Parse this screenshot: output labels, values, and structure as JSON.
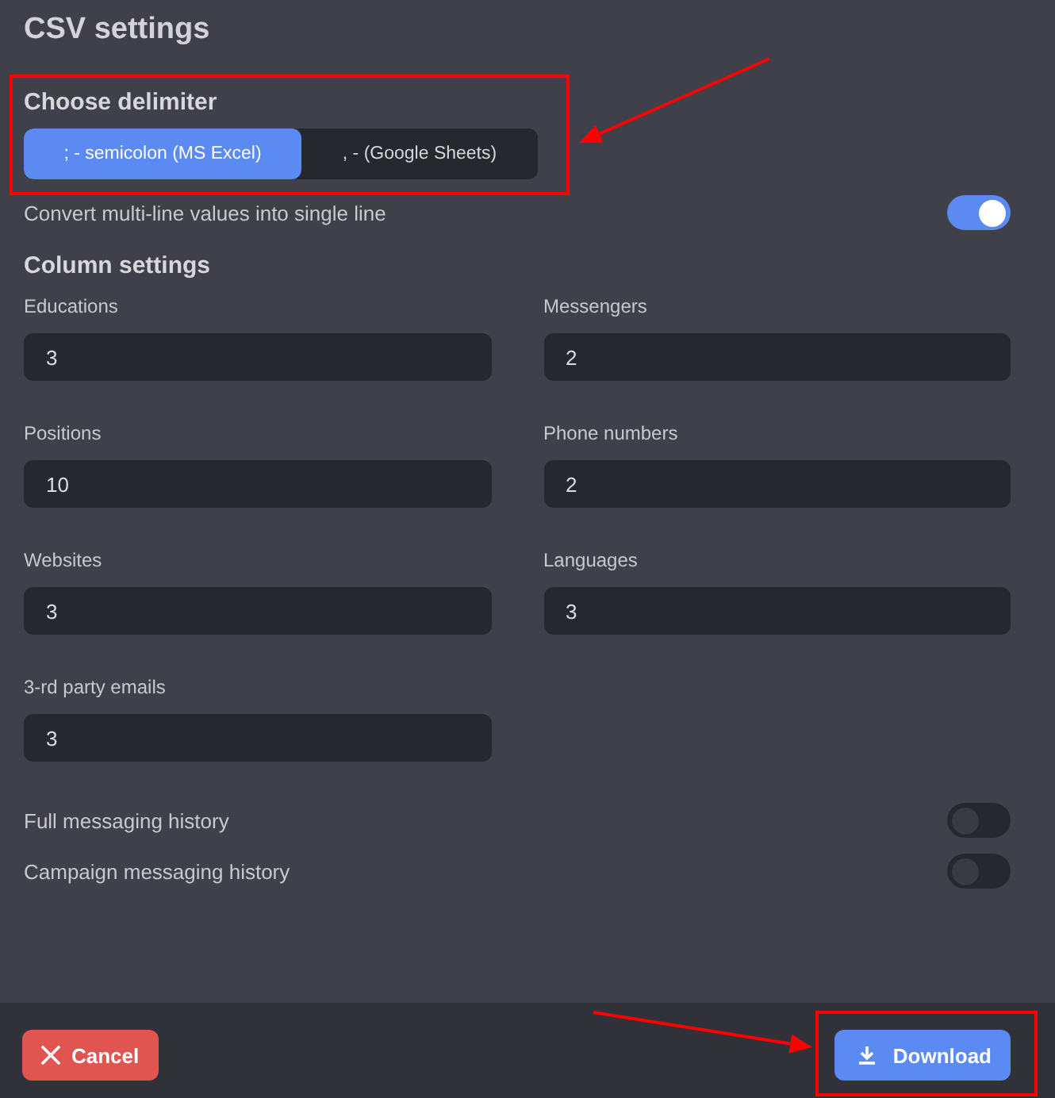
{
  "title": "CSV settings",
  "delimiter": {
    "label": "Choose delimiter",
    "options": [
      {
        "label": "; - semicolon (MS Excel)",
        "selected": true
      },
      {
        "label": ", - (Google Sheets)",
        "selected": false
      }
    ]
  },
  "convert_toggle": {
    "label": "Convert multi-line values into single line",
    "on": true
  },
  "column_settings": {
    "heading": "Column settings",
    "fields": [
      {
        "label": "Educations",
        "value": "3"
      },
      {
        "label": "Messengers",
        "value": "2"
      },
      {
        "label": "Positions",
        "value": "10"
      },
      {
        "label": "Phone numbers",
        "value": "2"
      },
      {
        "label": "Websites",
        "value": "3"
      },
      {
        "label": "Languages",
        "value": "3"
      },
      {
        "label": "3-rd party emails",
        "value": "3"
      }
    ]
  },
  "history_toggles": [
    {
      "label": "Full messaging history",
      "on": false
    },
    {
      "label": "Campaign messaging history",
      "on": false
    }
  ],
  "footer": {
    "cancel": "Cancel",
    "download": "Download"
  }
}
